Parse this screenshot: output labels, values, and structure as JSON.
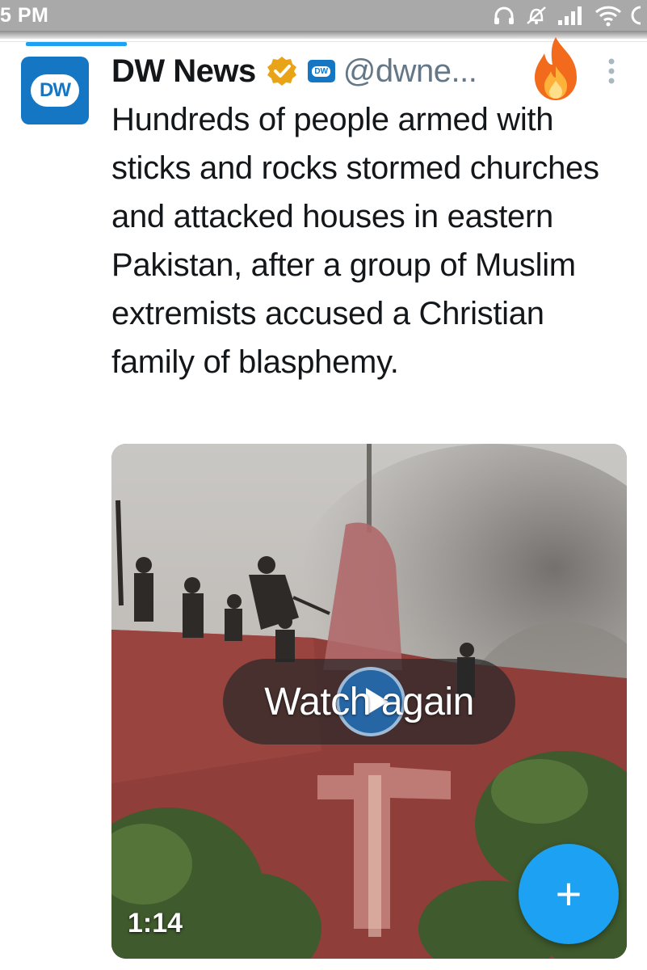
{
  "status_bar": {
    "time": "5 PM",
    "icons": [
      "headphones-icon",
      "alarm-off-icon",
      "signal-icon",
      "wifi-icon",
      "data-icon"
    ]
  },
  "tweet": {
    "display_name": "DW News",
    "handle": "@dwne...",
    "avatar_text": "DW",
    "mini_logo_text": "DW",
    "text": "Hundreds of people armed with sticks and rocks stormed churches and attacked houses in eastern Pakistan, after a group of Muslim extremists accused a Christian family of blasphemy.",
    "media": {
      "overlay_label": "Watch again",
      "duration": "1:14"
    }
  },
  "fab": {
    "label": "+"
  },
  "colors": {
    "accent": "#1da1f2",
    "brand": "#1576c4",
    "verified": "#e8a317"
  }
}
